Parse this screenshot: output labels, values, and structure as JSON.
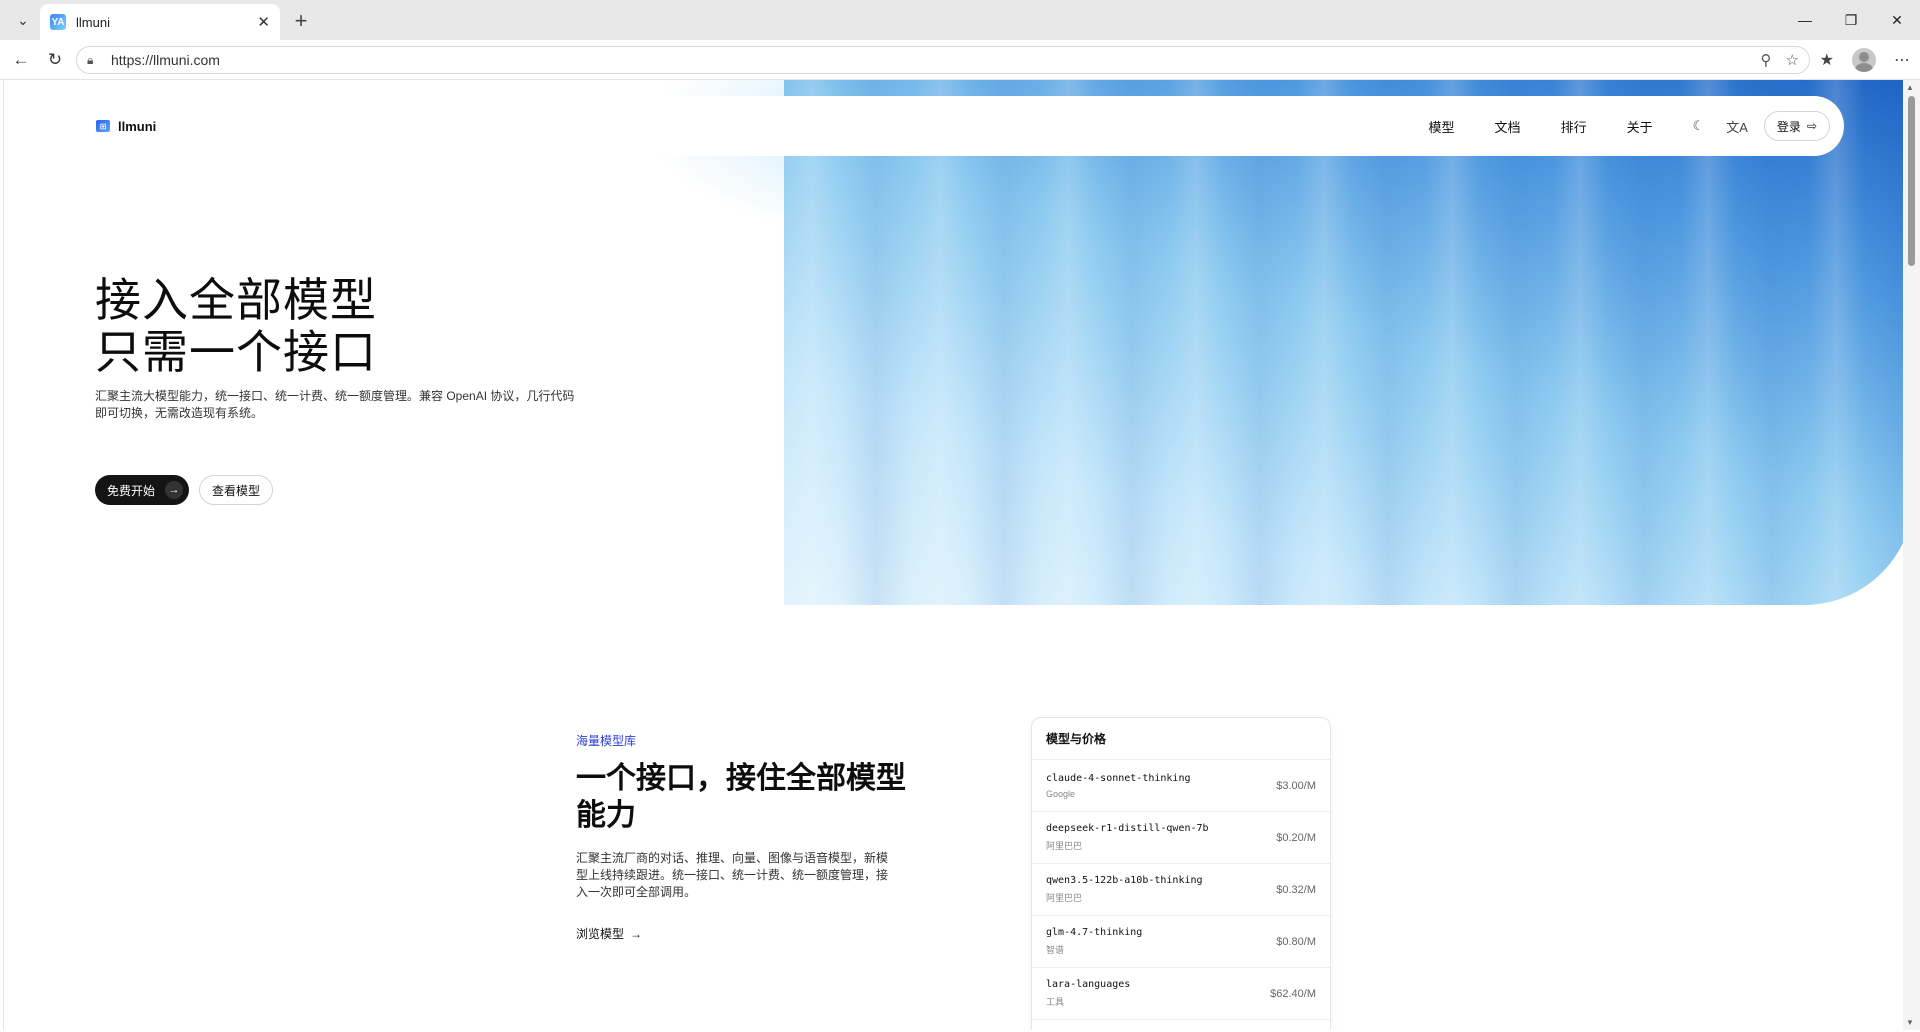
{
  "browser": {
    "tab_title": "llmuni",
    "tab_favicon_text": "YA",
    "url": "https://llmuni.com"
  },
  "nav": {
    "logo_text": "llmuni",
    "links": [
      "模型",
      "文档",
      "排行",
      "关于"
    ],
    "login_label": "登录"
  },
  "hero": {
    "title_line1": "接入全部模型",
    "title_line2": "只需一个接口",
    "description": "汇聚主流大模型能力，统一接口、统一计费、统一额度管理。兼容 OpenAI 协议，几行代码即可切换，无需改造现有系统。",
    "primary_button": "免费开始",
    "secondary_button": "查看模型"
  },
  "models_section": {
    "eyebrow": "海量模型库",
    "title": "一个接口，接住全部模型能力",
    "description": "汇聚主流厂商的对话、推理、向量、图像与语音模型，新模型上线持续跟进。统一接口、统一计费、统一额度管理，接入一次即可全部调用。",
    "link_label": "浏览模型",
    "card": {
      "title": "模型与价格",
      "rows": [
        {
          "name": "claude-4-sonnet-thinking",
          "vendor": "Google",
          "price": "$3.00/M"
        },
        {
          "name": "deepseek-r1-distill-qwen-7b",
          "vendor": "阿里巴巴",
          "price": "$0.20/M"
        },
        {
          "name": "qwen3.5-122b-a10b-thinking",
          "vendor": "阿里巴巴",
          "price": "$0.32/M"
        },
        {
          "name": "glm-4.7-thinking",
          "vendor": "智谱",
          "price": "$0.80/M"
        },
        {
          "name": "lara-languages",
          "vendor": "工具",
          "price": "$62.40/M"
        }
      ]
    }
  },
  "colors": {
    "hero_gradient_dark": "#1f63c4",
    "hero_gradient_light": "#e2f3fd",
    "eyebrow": "#2a3fd1",
    "primary_button_bg": "#141414"
  }
}
